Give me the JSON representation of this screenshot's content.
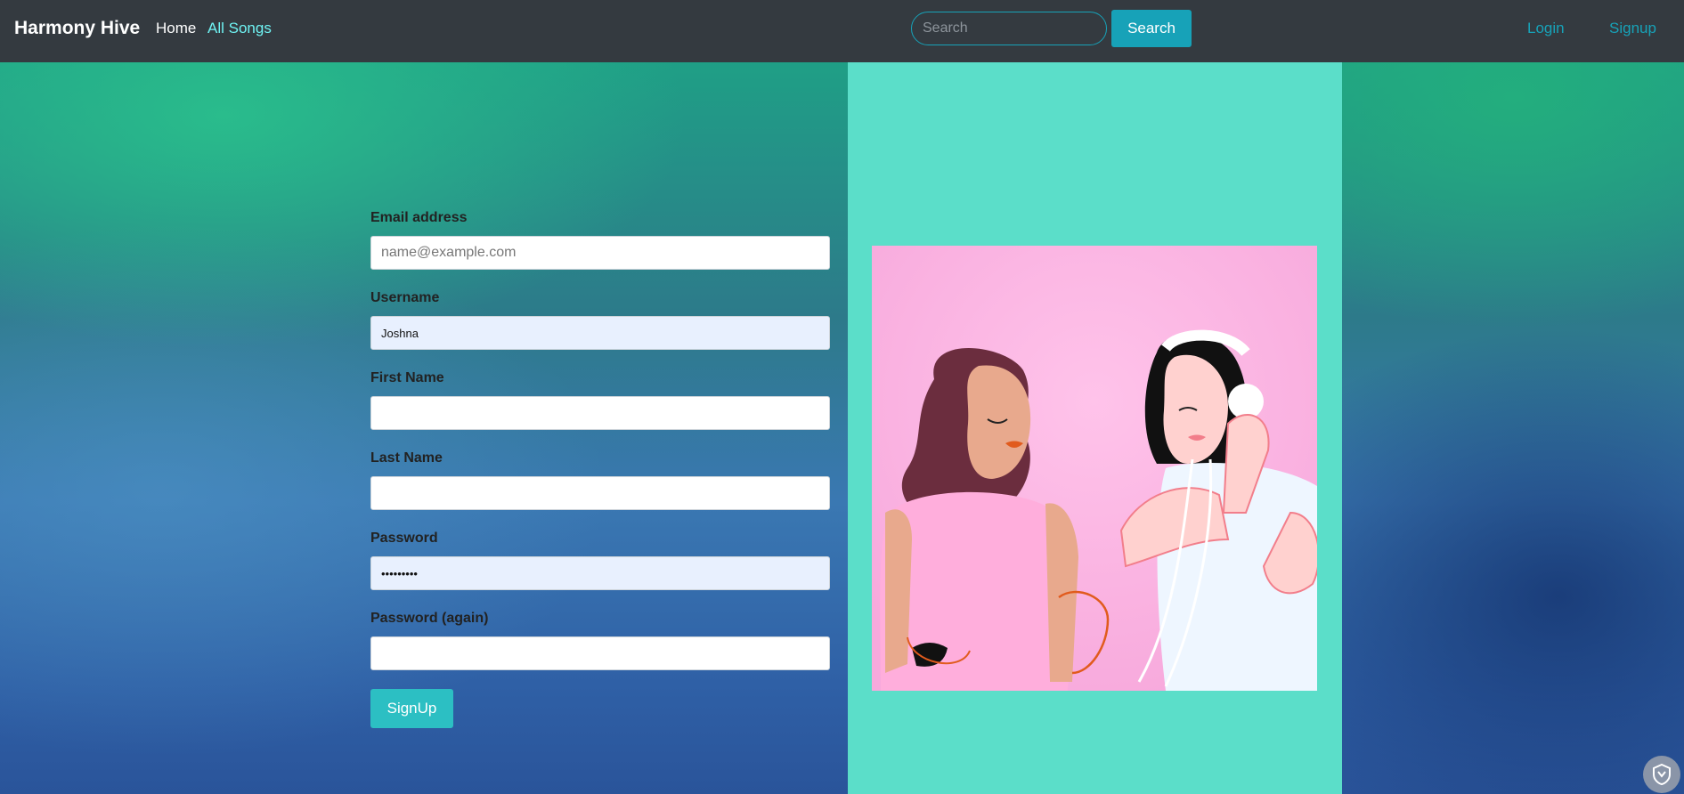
{
  "navbar": {
    "brand": "Harmony Hive",
    "home": "Home",
    "all_songs": "All Songs",
    "search_placeholder": "Search",
    "search_button": "Search",
    "login": "Login",
    "signup": "Signup"
  },
  "form": {
    "email_label": "Email address",
    "email_placeholder": "name@example.com",
    "email_value": "",
    "username_label": "Username",
    "username_value": "Joshna",
    "first_name_label": "First Name",
    "first_name_value": "",
    "last_name_label": "Last Name",
    "last_name_value": "",
    "password_label": "Password",
    "password_value": "•••••••••",
    "password_again_label": "Password (again)",
    "password_again_value": "",
    "submit_label": "SignUp"
  },
  "illustration": {
    "icon": "two-women-listening-music-illustration"
  },
  "colors": {
    "navbar": "#343a40",
    "accent": "#17a2b8",
    "panel": "#5bdec9",
    "signup_button": "#2cbfc3"
  },
  "floating": {
    "icon": "shield-icon"
  }
}
